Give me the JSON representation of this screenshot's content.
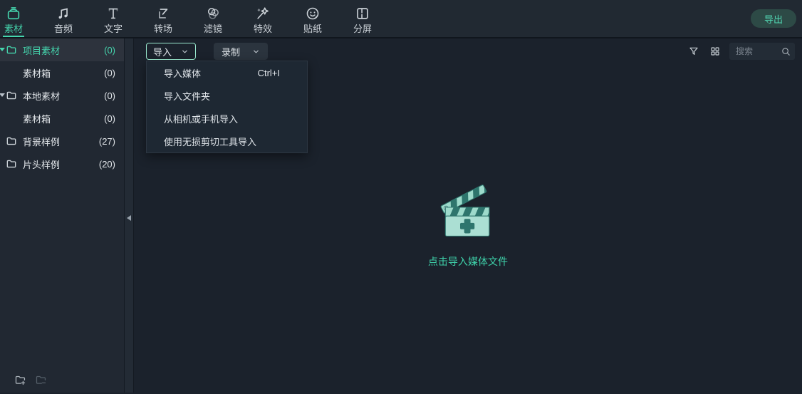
{
  "app": {
    "nav_tabs": [
      {
        "label": "素材",
        "icon": "media-bin-icon",
        "active": true
      },
      {
        "label": "音频",
        "icon": "music-note-icon",
        "active": false
      },
      {
        "label": "文字",
        "icon": "text-icon",
        "active": false
      },
      {
        "label": "转场",
        "icon": "transition-icon",
        "active": false
      },
      {
        "label": "滤镜",
        "icon": "filter-circles-icon",
        "active": false
      },
      {
        "label": "特效",
        "icon": "magic-wand-icon",
        "active": false
      },
      {
        "label": "贴纸",
        "icon": "sticker-face-icon",
        "active": false
      },
      {
        "label": "分屏",
        "icon": "split-screen-icon",
        "active": false
      }
    ],
    "export_label": "导出"
  },
  "sidebar": {
    "items": [
      {
        "label": "项目素材",
        "count": "(0)",
        "active": true,
        "caret": true,
        "folder": true
      },
      {
        "label": "素材箱",
        "count": "(0)",
        "active": false,
        "caret": false,
        "folder": false
      },
      {
        "label": "本地素材",
        "count": "(0)",
        "active": false,
        "caret": true,
        "folder": true
      },
      {
        "label": "素材箱",
        "count": "(0)",
        "active": false,
        "caret": false,
        "folder": false
      },
      {
        "label": "背景样例",
        "count": "(27)",
        "active": false,
        "caret": false,
        "folder": true
      },
      {
        "label": "片头样例",
        "count": "(20)",
        "active": false,
        "caret": false,
        "folder": true
      }
    ]
  },
  "toolbar": {
    "import_label": "导入",
    "record_label": "录制",
    "search_placeholder": "搜索"
  },
  "import_menu": {
    "items": [
      {
        "label": "导入媒体",
        "shortcut": "Ctrl+I"
      },
      {
        "label": "导入文件夹",
        "shortcut": ""
      },
      {
        "label": "从相机或手机导入",
        "shortcut": ""
      },
      {
        "label": "使用无损剪切工具导入",
        "shortcut": ""
      }
    ]
  },
  "empty_state": {
    "hint": "点击导入媒体文件"
  },
  "colors": {
    "accent": "#45d6ae",
    "export_bg": "#2d4a46",
    "export_text": "#52d8b4"
  }
}
